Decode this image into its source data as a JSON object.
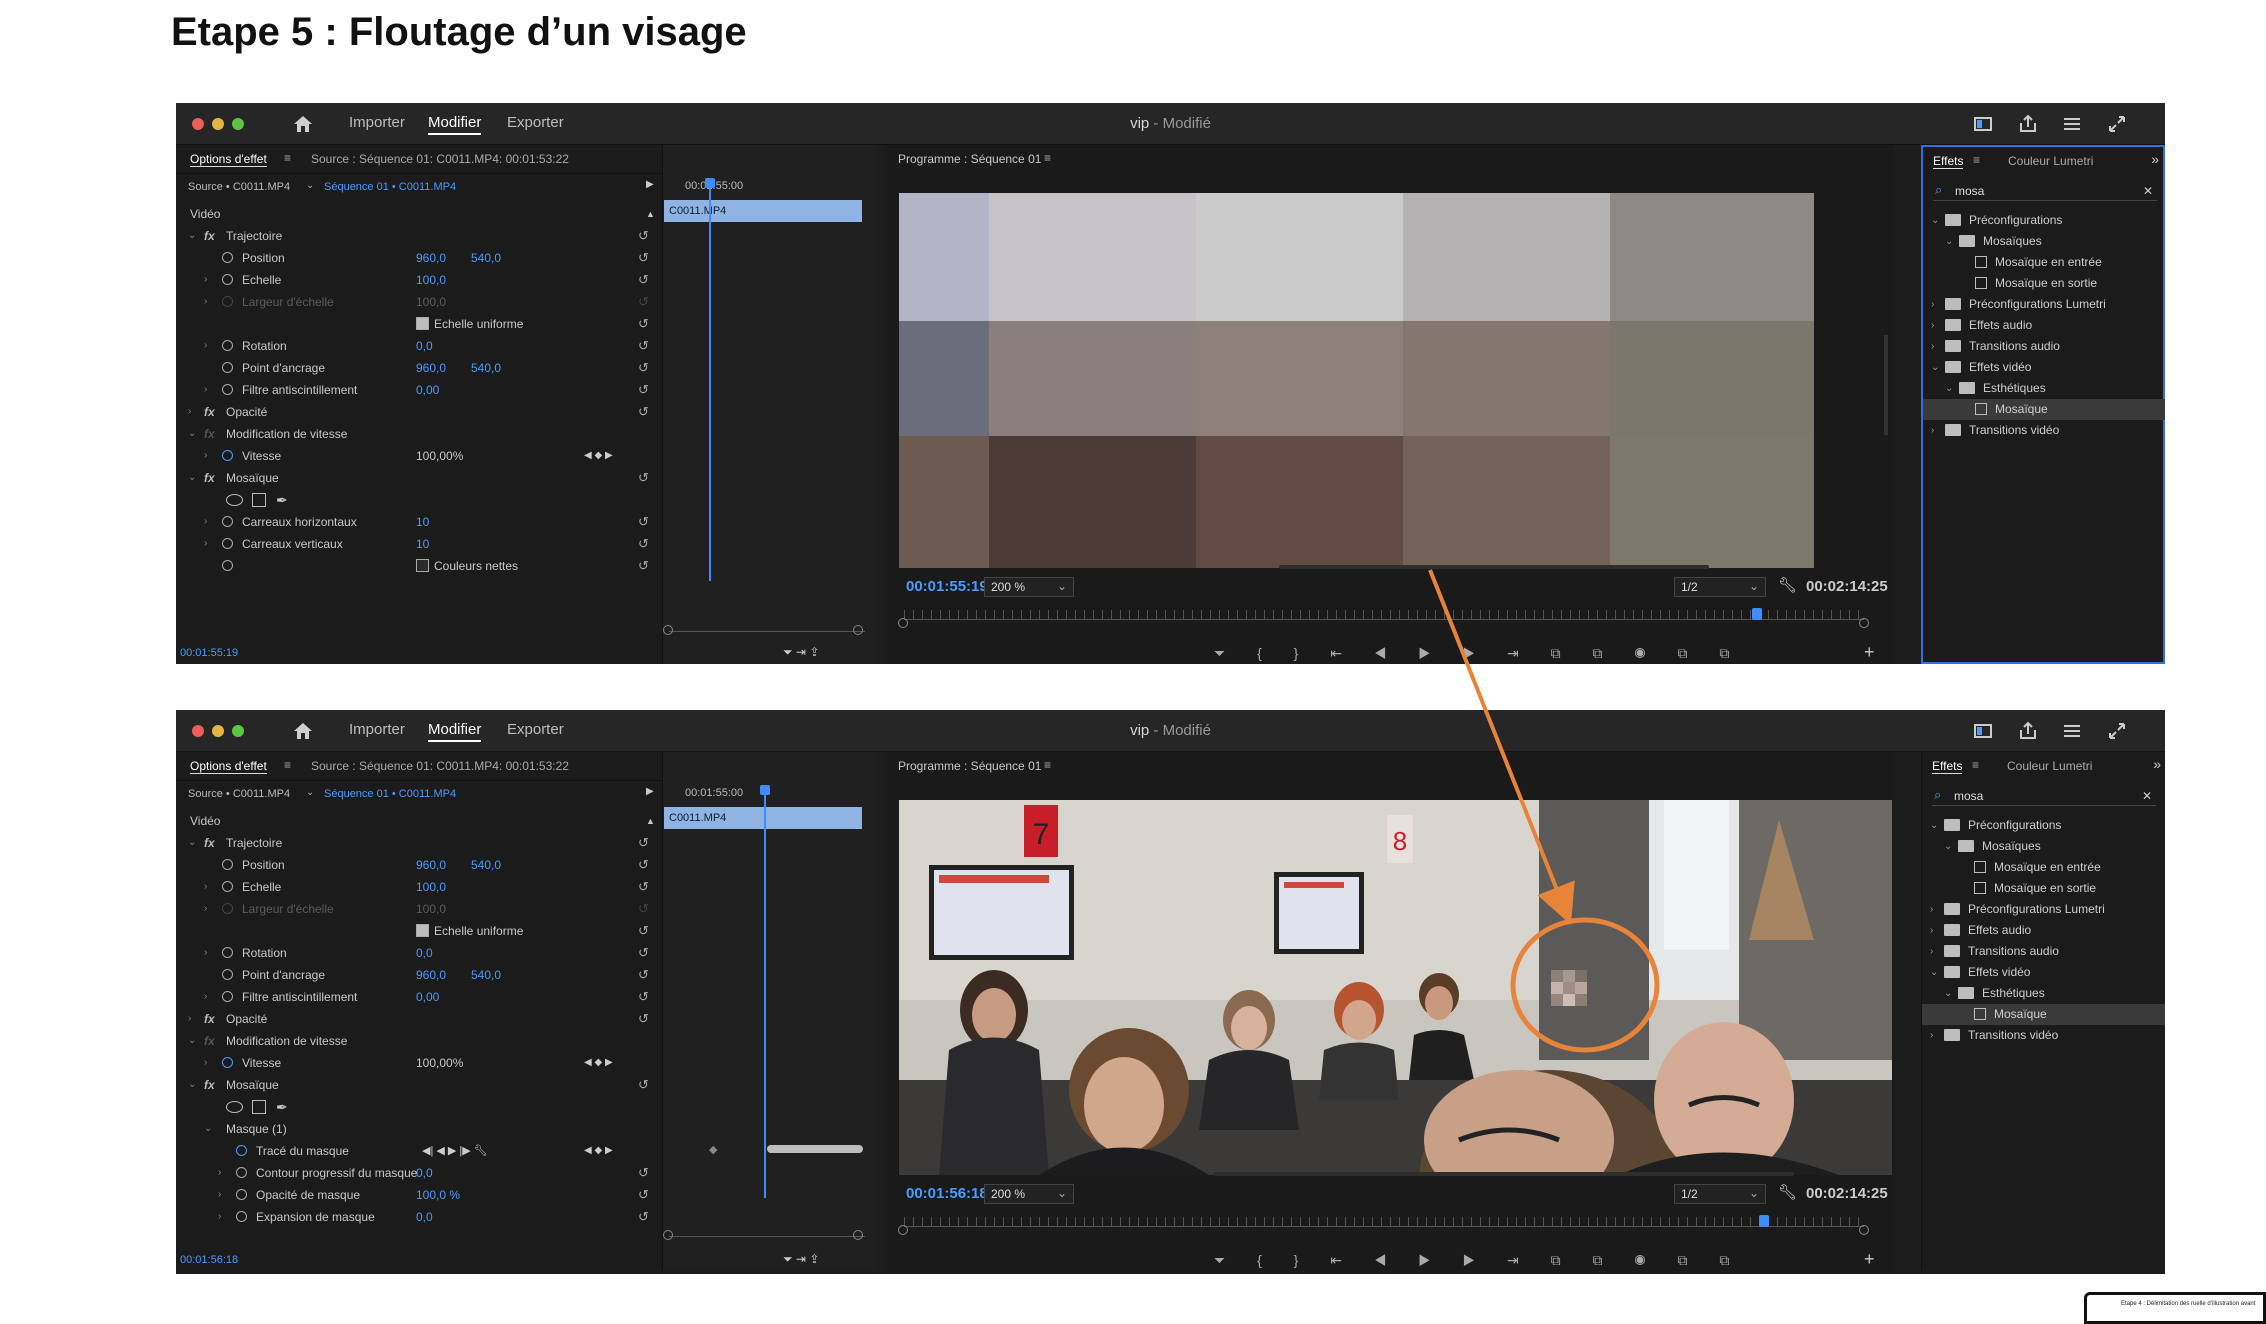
{
  "page": {
    "title": "Etape 5 : Floutage d’un visage"
  },
  "app": {
    "workspaces": [
      "Importer",
      "Modifier",
      "Exporter"
    ],
    "title_name": "vip",
    "title_status": " - Modifié"
  },
  "effect_options": {
    "tab": "Options d'effet",
    "source_title": "Source : Séquence 01: C0011.MP4: 00:01:53:22",
    "source_select": "Source • C0011.MP4",
    "sequence": "Séquence 01 • C0011.MP4",
    "video_header": "Vidéo",
    "clip_name": "C0011.MP4",
    "timecode_top": "00:01:55:00",
    "rows": {
      "trajectoire": "Trajectoire",
      "position": "Position",
      "position_x": "960,0",
      "position_y": "540,0",
      "echelle": "Echelle",
      "echelle_val": "100,0",
      "largeur": "Largeur d'échelle",
      "largeur_val": "100,0",
      "uniforme": "Echelle uniforme",
      "rotation": "Rotation",
      "rotation_val": "0,0",
      "ancrage": "Point d'ancrage",
      "ancrage_x": "960,0",
      "ancrage_y": "540,0",
      "filtre": "Filtre antiscintillement",
      "filtre_val": "0,00",
      "opacite": "Opacité",
      "modif_vitesse": "Modification de vitesse",
      "vitesse": "Vitesse",
      "vitesse_val": "100,00%",
      "mosaique": "Mosaïque",
      "carreaux_h": "Carreaux horizontaux",
      "carreaux_h_val": "10",
      "carreaux_v": "Carreaux verticaux",
      "carreaux_v_val": "10",
      "couleurs": "Couleurs nettes",
      "masque": "Masque (1)",
      "trace": "Tracé du masque",
      "contour": "Contour progressif du masque",
      "contour_val": "0,0",
      "opacite_masque": "Opacité de masque",
      "opacite_masque_val": "100,0 %",
      "expansion": "Expansion de masque",
      "expansion_val": "0,0"
    }
  },
  "program": {
    "title": "Programme : Séquence 01",
    "zoom": "200 %",
    "resolution": "1/2",
    "duration": "00:02:14:25"
  },
  "screenshot1": {
    "timecode": "00:01:55:19",
    "bottom_timecode": "00:01:55:19"
  },
  "screenshot2": {
    "timecode": "00:01:56:18",
    "bottom_timecode": "00:01:56:18"
  },
  "effects": {
    "tab": "Effets",
    "tab2": "Couleur Lumetri",
    "search": "mosa",
    "tree": [
      "Préconfigurations",
      "Mosaïques",
      "Mosaïque en entrée",
      "Mosaïque en sortie",
      "Préconfigurations Lumetri",
      "Effets audio",
      "Transitions audio",
      "Effets vidéo",
      "Esthétiques",
      "Mosaïque",
      "Transitions vidéo"
    ]
  },
  "video_frame": {
    "signs": [
      "7",
      "8"
    ]
  },
  "colors": {
    "accent": "#4a9cff",
    "annotation": "#e8833a",
    "panel_bg": "#1d1d1d"
  },
  "mosaic_colors": [
    [
      "#b3b4c6",
      "#c6c4c8",
      "#cbcbcb",
      "#b4b2b2",
      "#8e8987"
    ],
    [
      "#6b6d7c",
      "#8b7f7d",
      "#8e807a",
      "#85776f",
      "#7d766d"
    ],
    [
      "#6d5a51",
      "#4c3b36",
      "#624a45",
      "#73625a",
      "#7e776b"
    ]
  ],
  "thumbnail": {
    "caption": "Etape 4 : Délimitation des ruelle d’illustration avant"
  }
}
